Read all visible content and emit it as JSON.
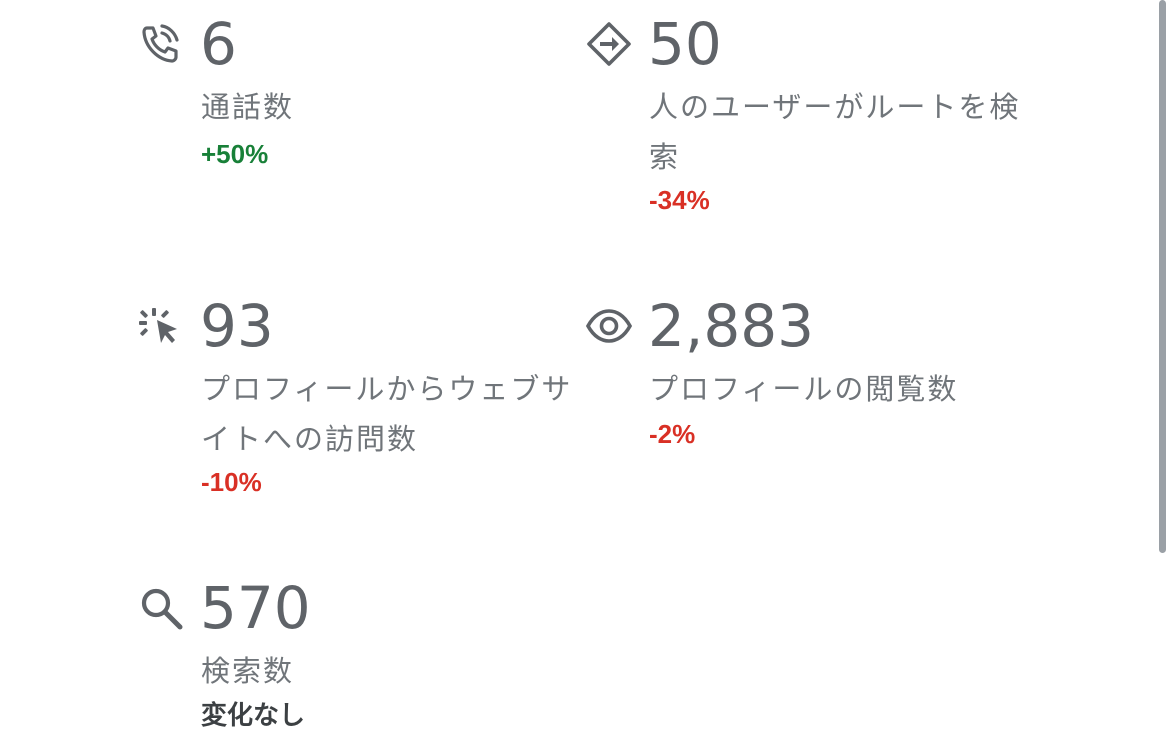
{
  "metrics": [
    {
      "icon": "phone-call-icon",
      "value": "6",
      "label": "通話数",
      "change": "+50%",
      "change_type": "positive"
    },
    {
      "icon": "directions-icon",
      "value": "50",
      "label": "人のユーザーがルートを検索",
      "change": "-34%",
      "change_type": "negative"
    },
    {
      "icon": "click-cursor-icon",
      "value": "93",
      "label": "プロフィールからウェブサイトへの訪問数",
      "change": "-10%",
      "change_type": "negative"
    },
    {
      "icon": "eye-icon",
      "value": "2,883",
      "label": "プロフィールの閲覧数",
      "change": "-2%",
      "change_type": "negative"
    },
    {
      "icon": "search-icon",
      "value": "570",
      "label": "検索数",
      "change": "変化なし",
      "change_type": "neutral"
    }
  ],
  "colors": {
    "value_text": "#5f6368",
    "label_text": "#70757a",
    "positive": "#188038",
    "negative": "#d93025",
    "neutral": "#3c4043"
  }
}
